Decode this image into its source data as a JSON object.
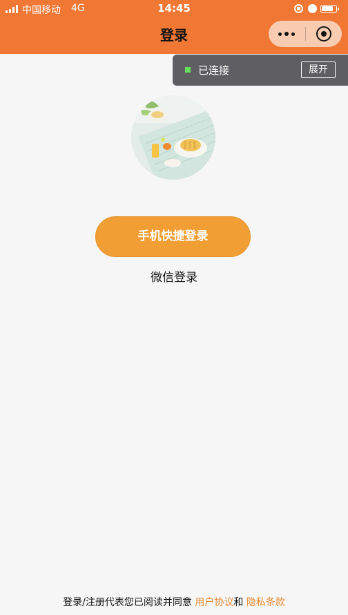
{
  "status_bar": {
    "carrier": "中国移动",
    "network": "4G",
    "time": "14:45"
  },
  "nav": {
    "title": "登录"
  },
  "toast": {
    "status_text": "已连接",
    "expand_label": "展开"
  },
  "login": {
    "phone_button_label": "手机快捷登录",
    "wechat_button_label": "微信登录"
  },
  "agreement": {
    "prefix": "登录/注册代表您已阅读并同意 ",
    "user_agreement": "用户协议",
    "conjunction": "和 ",
    "privacy_policy": "隐私条款"
  },
  "colors": {
    "nav_background": "#f07834",
    "primary_button": "#f19e35",
    "link": "#e88a30",
    "page_background": "#f6f6f6"
  }
}
